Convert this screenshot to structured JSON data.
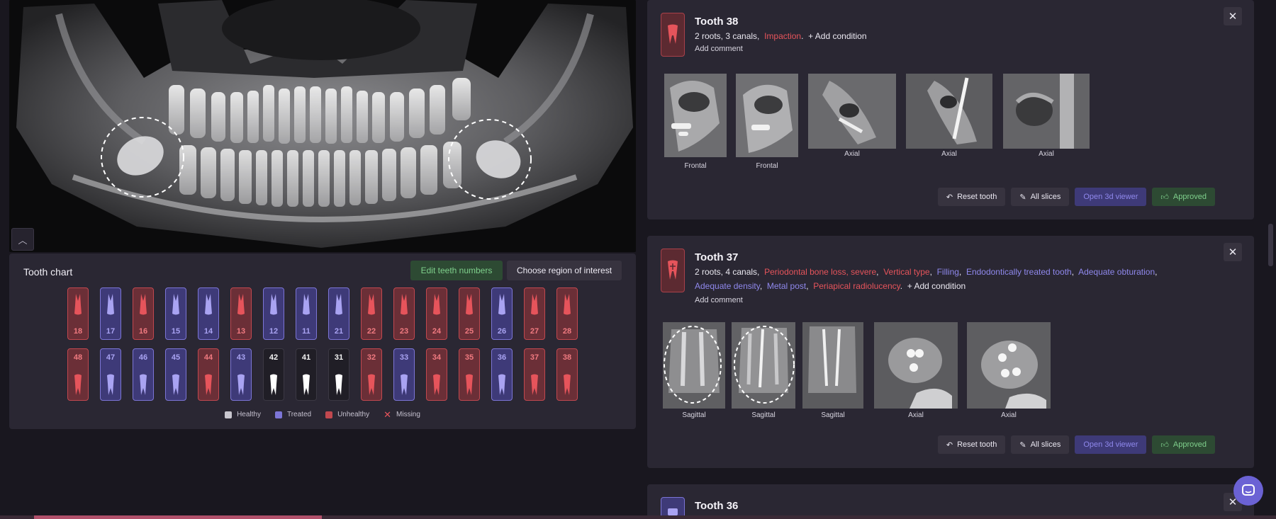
{
  "xray": {
    "alt": "Panoramic dental X-ray"
  },
  "collapse_icon": "chevron-up-icon",
  "tooth_chart": {
    "title": "Tooth chart",
    "edit_button": "Edit teeth numbers",
    "roi_button": "Choose region of interest",
    "upper": [
      {
        "num": "18",
        "status": "unhealthy"
      },
      {
        "num": "17",
        "status": "treated"
      },
      {
        "num": "16",
        "status": "unhealthy"
      },
      {
        "num": "15",
        "status": "treated"
      },
      {
        "num": "14",
        "status": "treated"
      },
      {
        "num": "13",
        "status": "unhealthy"
      },
      {
        "num": "12",
        "status": "treated"
      },
      {
        "num": "11",
        "status": "treated"
      },
      {
        "num": "21",
        "status": "treated"
      },
      {
        "num": "22",
        "status": "unhealthy"
      },
      {
        "num": "23",
        "status": "unhealthy"
      },
      {
        "num": "24",
        "status": "unhealthy"
      },
      {
        "num": "25",
        "status": "unhealthy"
      },
      {
        "num": "26",
        "status": "treated"
      },
      {
        "num": "27",
        "status": "unhealthy"
      },
      {
        "num": "28",
        "status": "unhealthy"
      }
    ],
    "lower": [
      {
        "num": "48",
        "status": "unhealthy"
      },
      {
        "num": "47",
        "status": "treated"
      },
      {
        "num": "46",
        "status": "treated"
      },
      {
        "num": "45",
        "status": "treated"
      },
      {
        "num": "44",
        "status": "unhealthy"
      },
      {
        "num": "43",
        "status": "treated"
      },
      {
        "num": "42",
        "status": "healthy"
      },
      {
        "num": "41",
        "status": "healthy"
      },
      {
        "num": "31",
        "status": "healthy"
      },
      {
        "num": "32",
        "status": "unhealthy"
      },
      {
        "num": "33",
        "status": "treated"
      },
      {
        "num": "34",
        "status": "unhealthy"
      },
      {
        "num": "35",
        "status": "unhealthy"
      },
      {
        "num": "36",
        "status": "treated"
      },
      {
        "num": "37",
        "status": "unhealthy"
      },
      {
        "num": "38",
        "status": "unhealthy"
      }
    ],
    "legend": {
      "healthy": "Healthy",
      "treated": "Treated",
      "unhealthy": "Unhealthy",
      "missing": "Missing"
    },
    "colors": {
      "healthy": "#c9c7cf",
      "treated": "#7c75d6",
      "unhealthy": "#c1484f",
      "missing": "#e6545b"
    }
  },
  "card_38": {
    "title": "Tooth 38",
    "roots_canals": "2 roots,  3 canals,",
    "conditions": [
      {
        "text": "Impaction",
        "color": "red"
      }
    ],
    "add_condition": "+ Add condition",
    "add_comment": "Add comment",
    "slices": [
      {
        "label": "Frontal"
      },
      {
        "label": "Frontal"
      },
      {
        "label": "Axial"
      },
      {
        "label": "Axial"
      },
      {
        "label": "Axial"
      }
    ],
    "actions": {
      "reset": "Reset tooth",
      "all_slices": "All slices",
      "open_3d": "Open 3d viewer",
      "approved": "Approved"
    }
  },
  "card_37": {
    "title": "Tooth 37",
    "roots_canals": "2 roots,  4 canals,",
    "line1": [
      {
        "text": "Periodontal bone loss, severe",
        "color": "red"
      },
      {
        "text": "Vertical type",
        "color": "red"
      },
      {
        "text": "Filling",
        "color": "purple"
      },
      {
        "text": "Endodontically treated tooth",
        "color": "purple"
      },
      {
        "text": "Adequate obturation",
        "color": "purple"
      }
    ],
    "line2": [
      {
        "text": "Adequate density",
        "color": "purple"
      },
      {
        "text": "Metal post",
        "color": "purple"
      },
      {
        "text": "Periapical radiolucency",
        "color": "red"
      }
    ],
    "add_condition": "+ Add condition",
    "add_comment": "Add comment",
    "slices": [
      {
        "label": "Sagittal"
      },
      {
        "label": "Sagittal"
      },
      {
        "label": "Sagittal"
      },
      {
        "label": "Axial"
      },
      {
        "label": "Axial"
      }
    ],
    "actions": {
      "reset": "Reset tooth",
      "all_slices": "All slices",
      "open_3d": "Open 3d viewer",
      "approved": "Approved"
    }
  },
  "card_36": {
    "title": "Tooth 36"
  },
  "close_label": "✕"
}
